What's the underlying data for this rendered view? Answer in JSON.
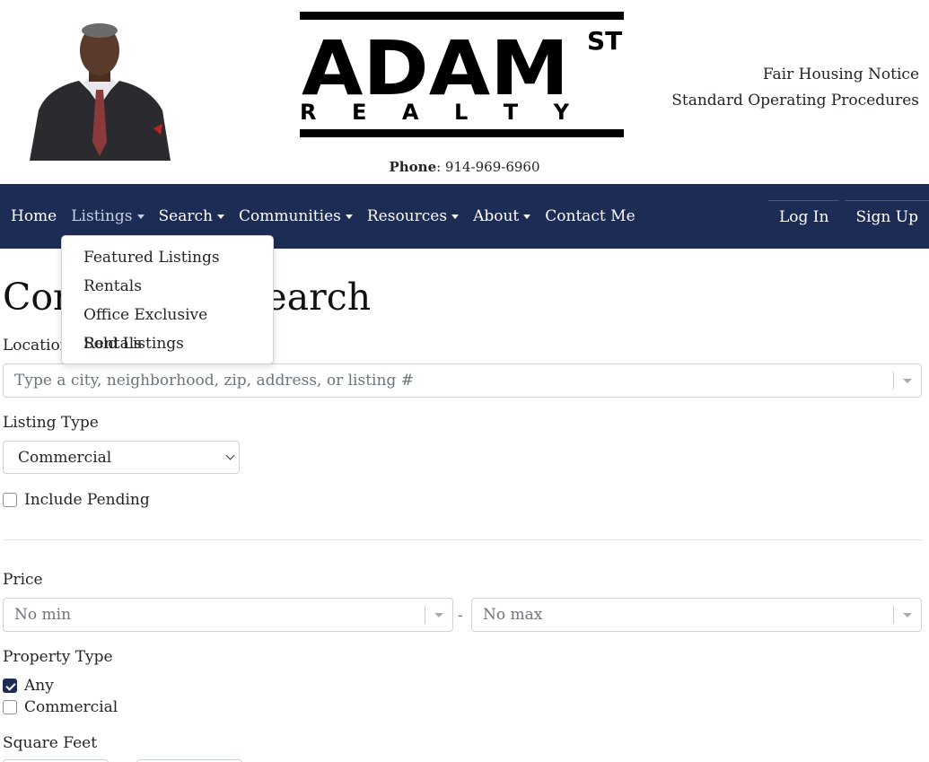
{
  "header": {
    "phone_label": "Phone",
    "phone_number": ": 914-969-6960",
    "links": [
      "Fair Housing Notice",
      "Standard Operating Procedures"
    ],
    "logo": {
      "main": "ADAM",
      "sup": "ST",
      "sub": "R E A L T Y"
    }
  },
  "nav": {
    "items": [
      {
        "label": "Home",
        "caret": false
      },
      {
        "label": "Listings",
        "caret": true
      },
      {
        "label": "Search",
        "caret": true
      },
      {
        "label": "Communities",
        "caret": true
      },
      {
        "label": "Resources",
        "caret": true
      },
      {
        "label": "About",
        "caret": true
      },
      {
        "label": "Contact Me",
        "caret": false
      }
    ],
    "login": "Log In",
    "signup": "Sign Up"
  },
  "dropdown": {
    "items": [
      "Featured Listings",
      "Rentals",
      "Office Exclusive Rentals",
      "Sold Listings"
    ]
  },
  "main": {
    "title": "Commercial Search",
    "location_label": "Location",
    "location_placeholder": "Type a city, neighborhood, zip, address, or listing #",
    "listing_type_label": "Listing Type",
    "listing_type_value": "Commercial",
    "include_pending": "Include Pending",
    "price_label": "Price",
    "price_min": "No min",
    "price_max": "No max",
    "price_dash": "-",
    "property_type_label": "Property Type",
    "property_types": [
      {
        "label": "Any",
        "checked": true
      },
      {
        "label": "Commercial",
        "checked": false
      }
    ],
    "sqft_label": "Square Feet"
  },
  "colors": {
    "navbar": "#1d2c55",
    "text": "#212529"
  }
}
